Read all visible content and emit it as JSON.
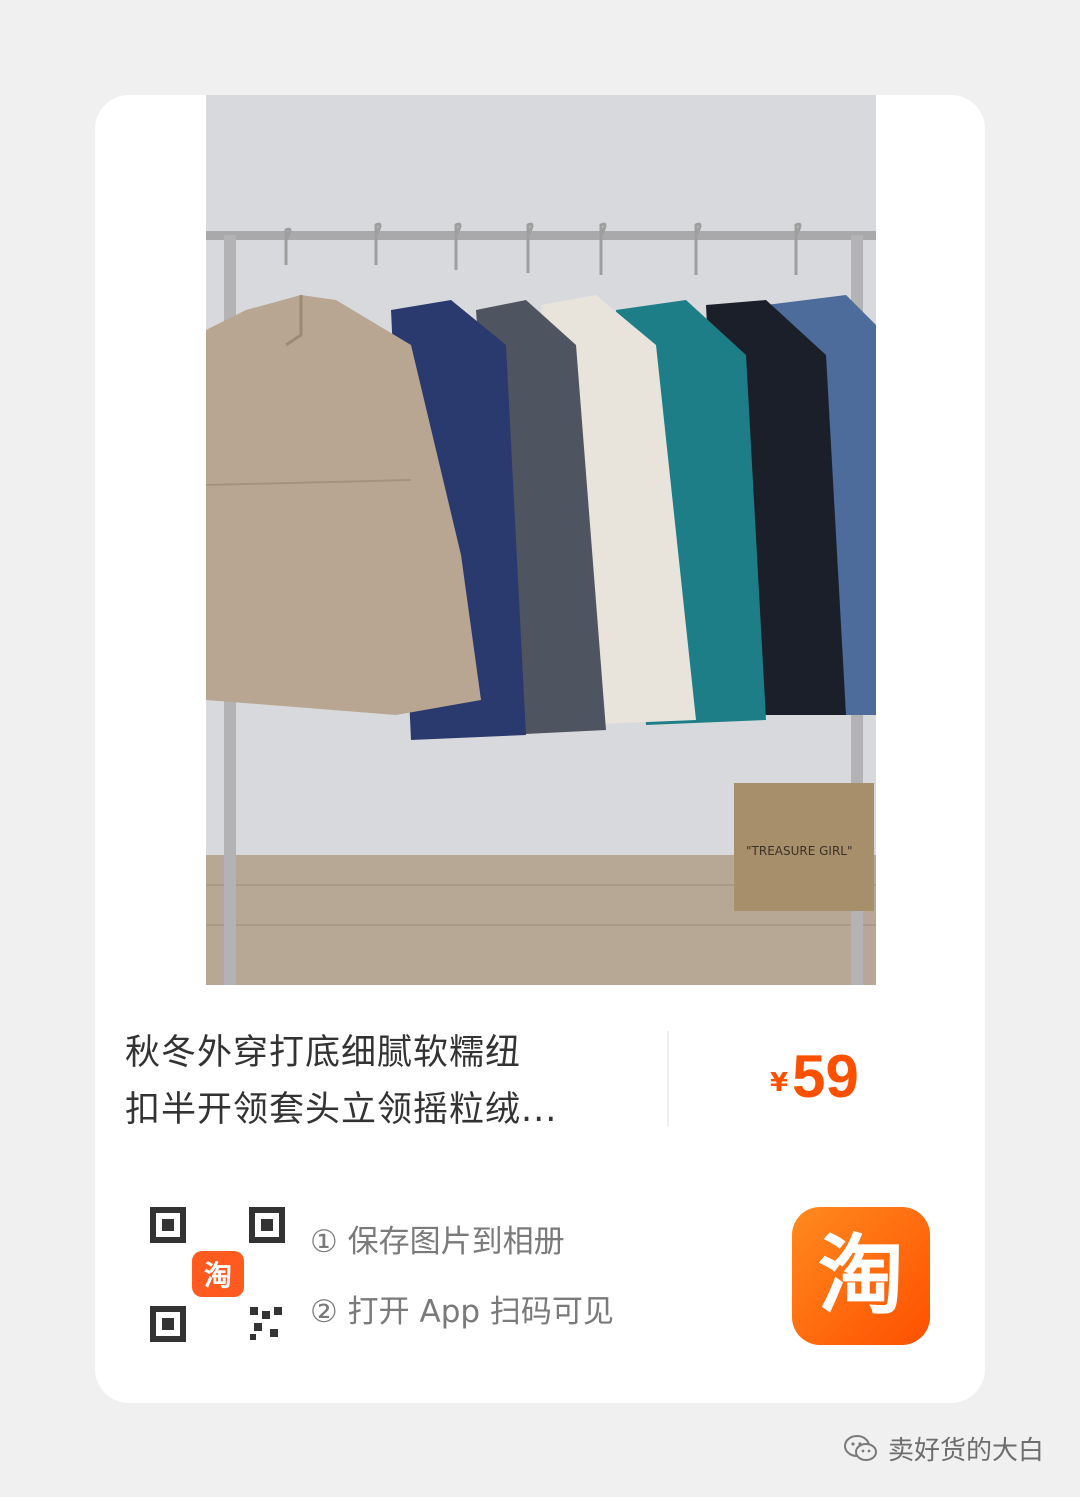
{
  "product": {
    "title": "秋冬外穿打底细腻软糯纽\n扣半开领套头立领摇粒绒...",
    "price_symbol": "¥",
    "price": "59",
    "photo_bag_text": "\"TREASURE GIRL\""
  },
  "share": {
    "step1": "① 保存图片到相册",
    "step2": "② 打开 App 扫码可见",
    "qr_badge_char": "淘",
    "app_logo_char": "淘"
  },
  "watermark": {
    "text": "卖好货的大白"
  },
  "colors": {
    "accent": "#ff5000",
    "background": "#f0f0f0",
    "card": "#ffffff",
    "jackets": [
      "#b9a692",
      "#2b3a6e",
      "#4f5560",
      "#e8e4dc",
      "#1e7e87",
      "#1b1f2a",
      "#4d6c9c"
    ]
  }
}
